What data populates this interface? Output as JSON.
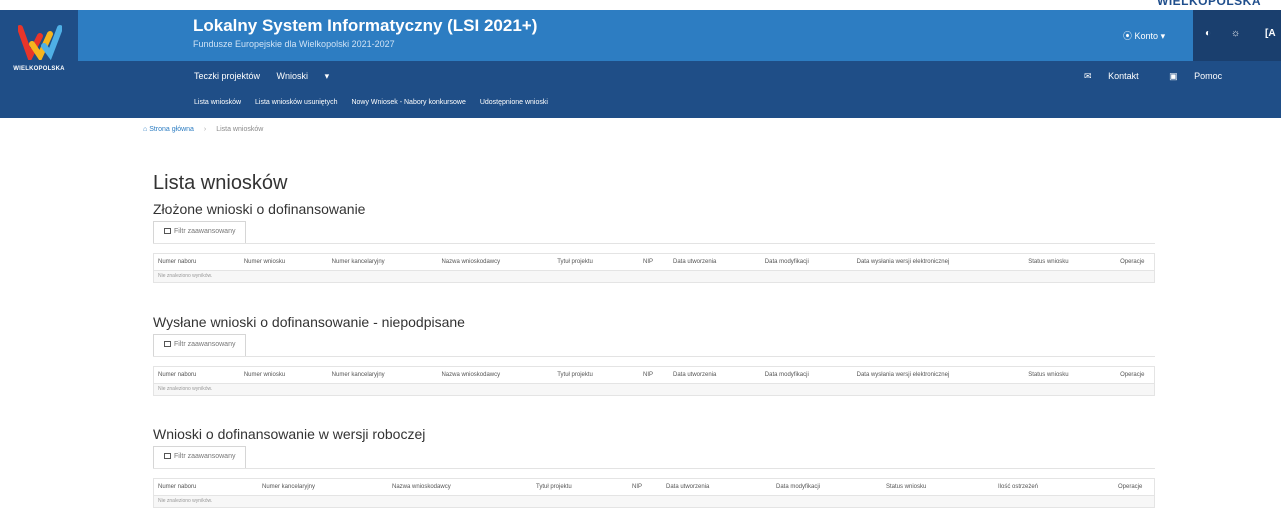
{
  "brand_top": "WIELKOPOLSKA",
  "logo": {
    "label": "WIELKOPOLSKA"
  },
  "header": {
    "title": "Lokalny System Informatyczny (LSI 2021+)",
    "subtitle": "Fundusze Europejskie dla Wielkopolski 2021-2027",
    "konto": "Konto",
    "contrast_icon": "◐",
    "brightness_icon": "☼",
    "font_label": "[A"
  },
  "nav": {
    "primary": [
      "Teczki projektów",
      "Wnioski"
    ],
    "right": [
      "Kontakt",
      "Pomoc"
    ],
    "sub": [
      "Lista wniosków",
      "Lista wniosków usuniętych",
      "Nowy Wniosek - Nabory konkursowe",
      "Udostępnione wnioski"
    ]
  },
  "breadcrumb": {
    "home": "Strona główna",
    "current": "Lista wniosków"
  },
  "page_title": "Lista wniosków",
  "filter_label": "Filtr zaawansowany",
  "empty_label": "Nie znaleziono wyników.",
  "sections": [
    {
      "title": "Złożone wnioski o dofinansowanie",
      "columns": [
        "Numer naboru",
        "Numer wniosku",
        "Numer kancelaryjny",
        "Nazwa wnioskodawcy",
        "Tytuł projektu",
        "NIP",
        "Data utworzenia",
        "Data modyfikacji",
        "Data wysłania wersji elektronicznej",
        "Status wniosku",
        "Operacje"
      ]
    },
    {
      "title": "Wysłane wnioski o dofinansowanie - niepodpisane",
      "columns": [
        "Numer naboru",
        "Numer wniosku",
        "Numer kancelaryjny",
        "Nazwa wnioskodawcy",
        "Tytuł projektu",
        "NIP",
        "Data utworzenia",
        "Data modyfikacji",
        "Data wysłania wersji elektronicznej",
        "Status wniosku",
        "Operacje"
      ]
    },
    {
      "title": "Wnioski o dofinansowanie w wersji roboczej",
      "columns": [
        "Numer naboru",
        "Numer kancelaryjny",
        "Nazwa wnioskodawcy",
        "Tytuł projektu",
        "NIP",
        "Data utworzenia",
        "Data modyfikacji",
        "Status wniosku",
        "Ilość ostrzeżeń",
        "Operacje"
      ]
    }
  ],
  "colors": {
    "header": "#2d7dc2",
    "nav": "#1f4e87",
    "accent_panel": "#1a3f6e"
  }
}
